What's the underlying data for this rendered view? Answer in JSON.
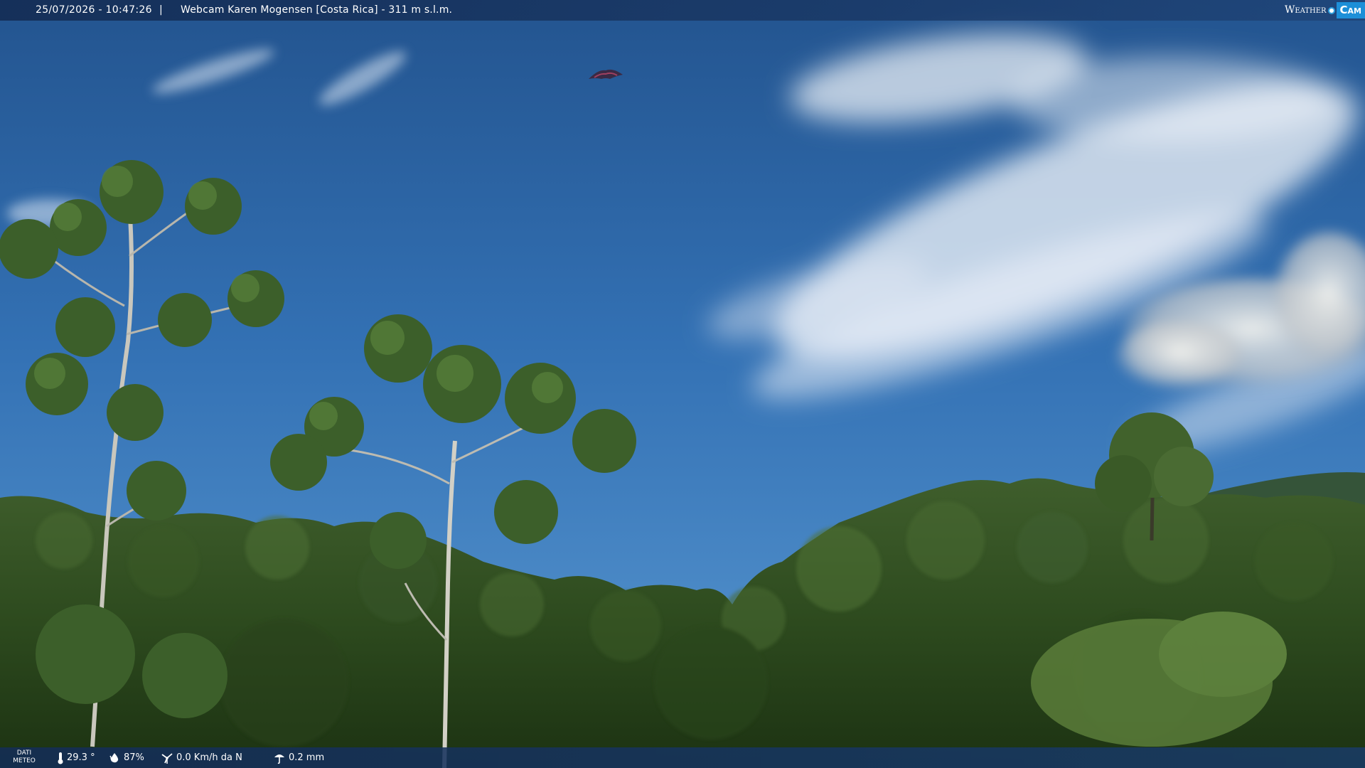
{
  "header": {
    "timestamp": "25/07/2026 - 10:47:26",
    "separator": "|",
    "title": "Webcam Karen Mogensen [Costa Rica]  - 311 m s.l.m.",
    "logo_word": "Weather",
    "logo_cam": "Cam"
  },
  "footer": {
    "meteo_label_line1": "DATI",
    "meteo_label_line2": "METEO",
    "temperature": "29.3 °",
    "humidity": "87%",
    "wind": "0.0 Km/h da N",
    "rain": "0.2 mm"
  },
  "icons": {
    "temperature": "thermometer-icon",
    "humidity": "droplet-icon",
    "wind": "wind-icon",
    "rain": "rain-gauge-icon"
  },
  "colors": {
    "bar_bg": "#1c3a66",
    "logo_accent": "#1d8fd8",
    "sky_top": "#23548f",
    "sky_bottom": "#4d8fcb",
    "forest": "#2e4a1f"
  }
}
